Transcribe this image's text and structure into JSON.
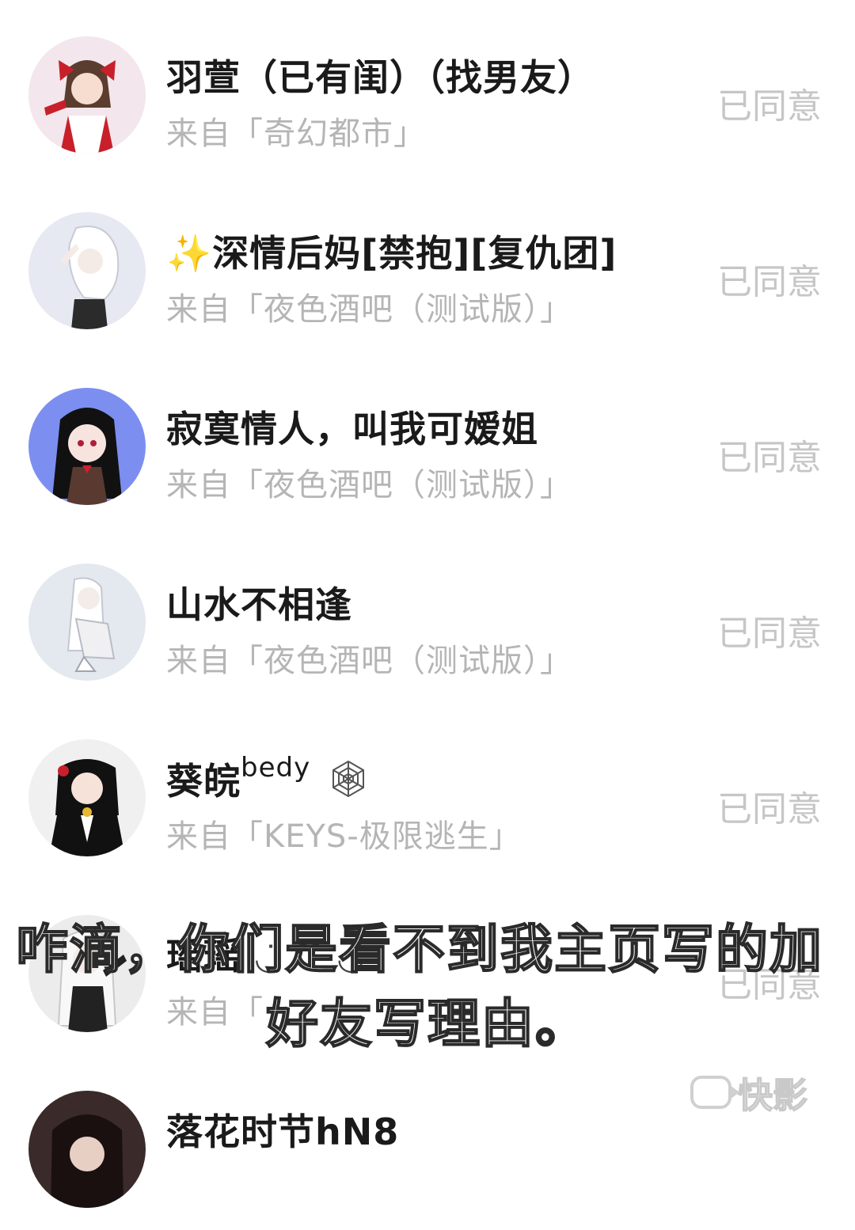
{
  "requests": [
    {
      "name": "羽萱（已有闺）（找男友）",
      "name_sup": "",
      "source": "来自「奇幻都市」",
      "status": "已同意",
      "avatar_icon": "avatar-girl-red-bow",
      "avatar_bg": "#f3e6ec",
      "avatar_fg": "#c8202a"
    },
    {
      "name": "✨深情后妈[禁抱][复仇团]",
      "name_sup": "",
      "source": "来自「夜色酒吧（测试版）」",
      "status": "已同意",
      "avatar_icon": "avatar-girl-white-hair",
      "avatar_bg": "#e6e8f2",
      "avatar_fg": "#2b2b2b"
    },
    {
      "name": "寂寞情人，叫我可嫒姐",
      "name_sup": "",
      "source": "来自「夜色酒吧（测试版）」",
      "status": "已同意",
      "avatar_icon": "avatar-girl-black-hair",
      "avatar_bg": "#7c8ff0",
      "avatar_fg": "#111111"
    },
    {
      "name": "山水不相逢",
      "name_sup": "",
      "source": "来自「夜色酒吧（测试版）」",
      "status": "已同意",
      "avatar_icon": "avatar-girl-sitting",
      "avatar_bg": "#e4e8ef",
      "avatar_fg": "#9aa1b0"
    },
    {
      "name": "葵皖",
      "name_sup": "bedy",
      "source": "来自「KEYS-极限逃生」",
      "status": "已同意",
      "avatar_icon": "avatar-girl-suit",
      "avatar_bg": "#f0f0f0",
      "avatar_fg": "#111111"
    },
    {
      "name": "瑶瑶",
      "name_sup": "",
      "source": "来自「",
      "status": "已同意",
      "avatar_icon": "avatar-girl-silver-hair",
      "avatar_bg": "#ececec",
      "avatar_fg": "#222222"
    },
    {
      "name": "落花时节hN8",
      "name_sup": "",
      "source": "",
      "status": "",
      "avatar_icon": "avatar-girl-dark",
      "avatar_bg": "#3a2a2a",
      "avatar_fg": "#1a1010"
    }
  ],
  "subtitle": {
    "line1": "咋滴，你们是看不到我主页写的加",
    "line2": "好友写理由。"
  },
  "watermark": {
    "label": "快影",
    "icon": "kuaiying-logo-icon"
  }
}
